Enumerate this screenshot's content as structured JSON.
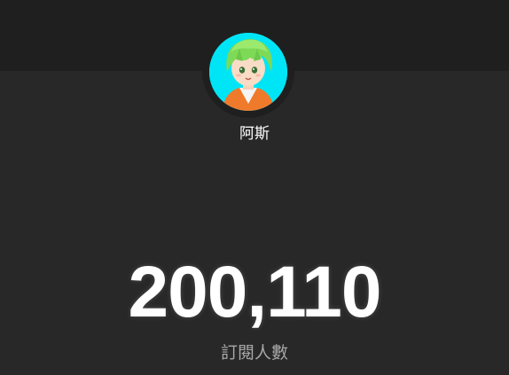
{
  "channel": {
    "name": "阿斯",
    "avatar_icon": "anime-avatar-green-hair"
  },
  "subscribers": {
    "count": "200,110",
    "label": "訂閱人數"
  },
  "colors": {
    "background": "#282828",
    "top_band": "#1f1f1f",
    "avatar_bg": "#00e5f5",
    "count_text": "#ffffff",
    "label_text": "#a8a8a8"
  }
}
